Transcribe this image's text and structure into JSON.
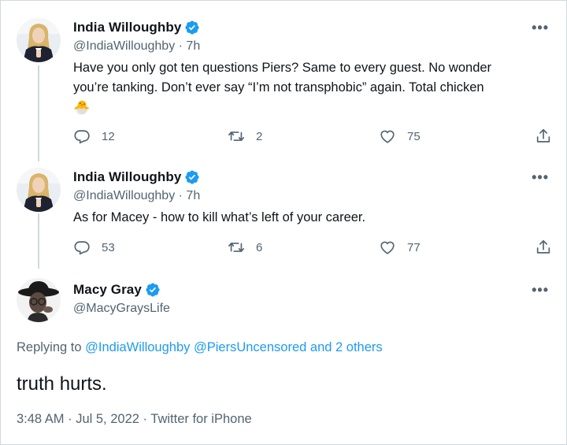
{
  "tweets": [
    {
      "name": "India Willoughby",
      "handle": "@IndiaWilloughby",
      "time": "· 7h",
      "text_line1": "Have you only got ten questions Piers? Same to every guest. No wonder",
      "text_line2": "you’re tanking. Don’t ever say “I’m not transphobic” again. Total chicken",
      "emoji": "🐣",
      "replies": "12",
      "retweets": "2",
      "likes": "75",
      "more": "•••"
    },
    {
      "name": "India Willoughby",
      "handle": "@IndiaWilloughby",
      "time": "· 7h",
      "text_line1": "As for Macey - how to kill what’s left of your career.",
      "replies": "53",
      "retweets": "6",
      "likes": "77",
      "more": "•••"
    }
  ],
  "main_tweet": {
    "name": "Macy Gray",
    "handle": "@MacyGraysLife",
    "more": "•••",
    "replying_prefix": "Replying to",
    "mention1": "@IndiaWilloughby",
    "mention2": "@PiersUncensored",
    "mention_more": "and 2 others",
    "text": "truth hurts.",
    "meta": "3:48 AM · Jul 5, 2022 · Twitter for iPhone"
  },
  "icons": {
    "verified": "verified-badge-icon",
    "reply": "reply-icon",
    "retweet": "retweet-icon",
    "like": "heart-icon",
    "share": "share-icon"
  },
  "colors": {
    "accent": "#1d9bf0",
    "secondary_text": "#536471",
    "primary_text": "#0f1419",
    "thread_line": "#cfd9de"
  }
}
